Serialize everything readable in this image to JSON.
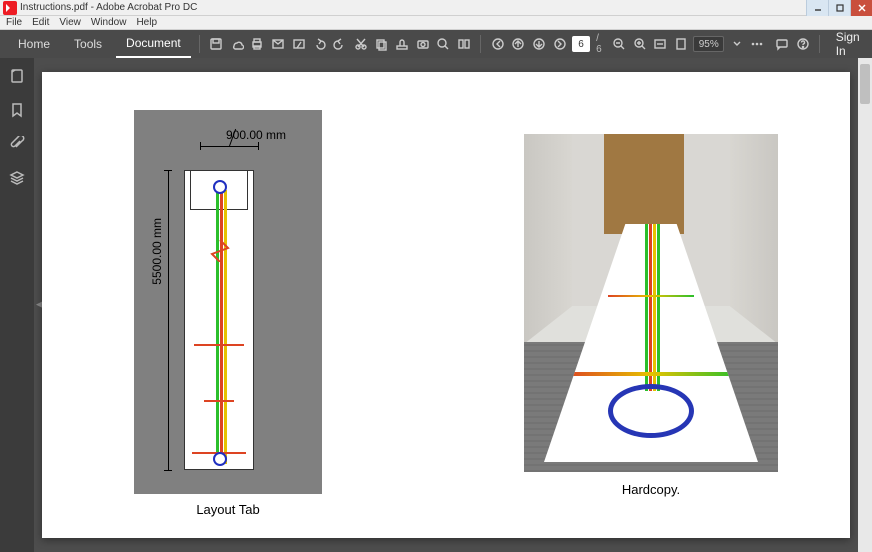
{
  "window": {
    "title": "Instructions.pdf - Adobe Acrobat Pro DC"
  },
  "menu": {
    "file": "File",
    "edit": "Edit",
    "view": "View",
    "window": "Window",
    "help": "Help"
  },
  "tabs": {
    "home": "Home",
    "tools": "Tools",
    "document": "Document"
  },
  "page": {
    "current": "6",
    "total": "/  6"
  },
  "zoom": {
    "value": "95%"
  },
  "signin": "Sign In",
  "figure": {
    "width_label": "900.00 mm",
    "height_label": "5500.00 mm",
    "left_caption": "Layout Tab",
    "right_caption": "Hardcopy."
  }
}
